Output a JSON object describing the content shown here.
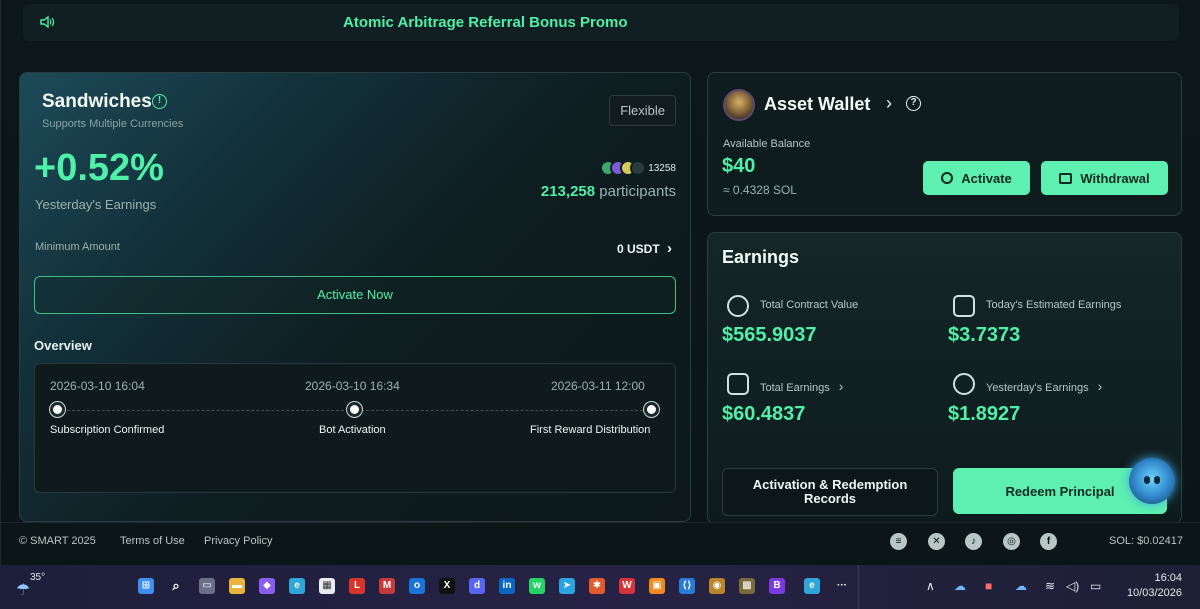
{
  "promo": {
    "text": "Atomic Arbitrage Referral Bonus Promo",
    "icon": "speaker-icon"
  },
  "product": {
    "title": "Sandwiches",
    "subtitle": "Supports Multiple Currencies",
    "tag": "Flexible",
    "yesterday_pct": "+0.52%",
    "yesterday_label": "Yesterday's Earnings",
    "avatar_count": "13258",
    "participants_num": "213,258",
    "participants_word": "participants",
    "min_label": "Minimum Amount",
    "min_value": "0 USDT",
    "min_chevron": "›",
    "activate_label": "Activate Now",
    "overview_title": "Overview",
    "timeline": [
      {
        "date": "2026-03-10 16:04",
        "label": "Subscription Confirmed"
      },
      {
        "date": "2026-03-10 16:34",
        "label": "Bot Activation"
      },
      {
        "date": "2026-03-11 12:00",
        "label": "First Reward Distribution"
      }
    ]
  },
  "wallet": {
    "title": "Asset Wallet",
    "chevron": "›",
    "help": "?",
    "available_label": "Available Balance",
    "available_value": "$40",
    "available_sol": "≈ 0.4328 SOL",
    "activate_label": "Activate",
    "withdraw_label": "Withdrawal"
  },
  "earnings": {
    "title": "Earnings",
    "metrics": [
      {
        "label": "Total Contract Value",
        "value": "$565.9037",
        "icon": "user-icon"
      },
      {
        "label": "Today's Estimated Earnings",
        "value": "$3.7373",
        "icon": "calendar-plus-icon"
      },
      {
        "label": "Total Earnings",
        "value": "$60.4837",
        "icon": "document-icon",
        "chevron": "›"
      },
      {
        "label": "Yesterday's Earnings",
        "value": "$1.8927",
        "icon": "shield-icon",
        "chevron": "›"
      }
    ],
    "records_label": "Activation & Redemption Records",
    "redeem_label": "Redeem Principal"
  },
  "footer": {
    "copyright": "© SMART 2025",
    "terms": "Terms of Use",
    "privacy": "Privacy Policy",
    "socials": [
      "layers-icon",
      "x-icon",
      "tiktok-icon",
      "instagram-icon",
      "facebook-icon"
    ],
    "sol_price": "SOL: $0.02417"
  },
  "taskbar": {
    "temperature": "35°",
    "time": "16:04",
    "date": "10/03/2026"
  },
  "colors": {
    "accent": "#4ff0a8",
    "button": "#5ef0b0",
    "background": "#0b1517"
  }
}
